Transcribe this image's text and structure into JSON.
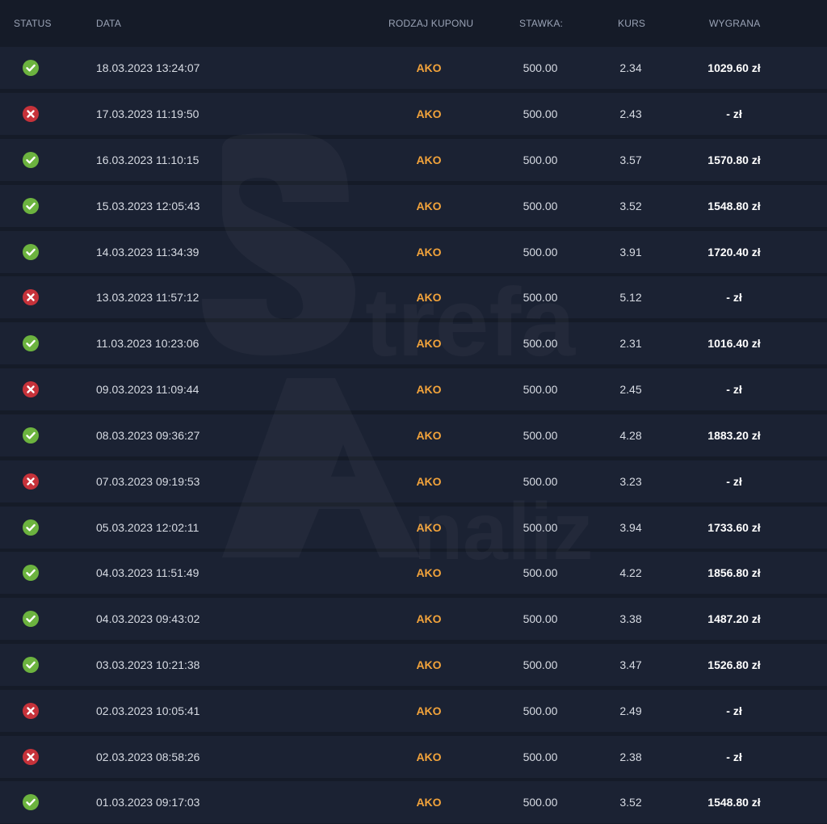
{
  "table": {
    "headers": {
      "status": "STATUS",
      "date": "DATA",
      "coupon_type": "RODZAJ KUPONU",
      "stake": "STAWKA:",
      "odds": "KURS",
      "win": "WYGRANA"
    },
    "rows": [
      {
        "status": "won",
        "date": "18.03.2023 13:24:07",
        "type": "AKO",
        "stake": "500.00",
        "odds": "2.34",
        "win": "1029.60 zł"
      },
      {
        "status": "lost",
        "date": "17.03.2023 11:19:50",
        "type": "AKO",
        "stake": "500.00",
        "odds": "2.43",
        "win": "- zł"
      },
      {
        "status": "won",
        "date": "16.03.2023 11:10:15",
        "type": "AKO",
        "stake": "500.00",
        "odds": "3.57",
        "win": "1570.80 zł"
      },
      {
        "status": "won",
        "date": "15.03.2023 12:05:43",
        "type": "AKO",
        "stake": "500.00",
        "odds": "3.52",
        "win": "1548.80 zł"
      },
      {
        "status": "won",
        "date": "14.03.2023 11:34:39",
        "type": "AKO",
        "stake": "500.00",
        "odds": "3.91",
        "win": "1720.40 zł"
      },
      {
        "status": "lost",
        "date": "13.03.2023 11:57:12",
        "type": "AKO",
        "stake": "500.00",
        "odds": "5.12",
        "win": "- zł"
      },
      {
        "status": "won",
        "date": "11.03.2023 10:23:06",
        "type": "AKO",
        "stake": "500.00",
        "odds": "2.31",
        "win": "1016.40 zł"
      },
      {
        "status": "lost",
        "date": "09.03.2023 11:09:44",
        "type": "AKO",
        "stake": "500.00",
        "odds": "2.45",
        "win": "- zł"
      },
      {
        "status": "won",
        "date": "08.03.2023 09:36:27",
        "type": "AKO",
        "stake": "500.00",
        "odds": "4.28",
        "win": "1883.20 zł"
      },
      {
        "status": "lost",
        "date": "07.03.2023 09:19:53",
        "type": "AKO",
        "stake": "500.00",
        "odds": "3.23",
        "win": "- zł"
      },
      {
        "status": "won",
        "date": "05.03.2023 12:02:11",
        "type": "AKO",
        "stake": "500.00",
        "odds": "3.94",
        "win": "1733.60 zł"
      },
      {
        "status": "won",
        "date": "04.03.2023 11:51:49",
        "type": "AKO",
        "stake": "500.00",
        "odds": "4.22",
        "win": "1856.80 zł"
      },
      {
        "status": "won",
        "date": "04.03.2023 09:43:02",
        "type": "AKO",
        "stake": "500.00",
        "odds": "3.38",
        "win": "1487.20 zł"
      },
      {
        "status": "won",
        "date": "03.03.2023 10:21:38",
        "type": "AKO",
        "stake": "500.00",
        "odds": "3.47",
        "win": "1526.80 zł"
      },
      {
        "status": "lost",
        "date": "02.03.2023 10:05:41",
        "type": "AKO",
        "stake": "500.00",
        "odds": "2.49",
        "win": "- zł"
      },
      {
        "status": "lost",
        "date": "02.03.2023 08:58:26",
        "type": "AKO",
        "stake": "500.00",
        "odds": "2.38",
        "win": "- zł"
      },
      {
        "status": "won",
        "date": "01.03.2023 09:17:03",
        "type": "AKO",
        "stake": "500.00",
        "odds": "3.52",
        "win": "1548.80 zł"
      }
    ]
  },
  "status_icons": {
    "won": {
      "icon": "check-circle-icon",
      "color": "#6cb33f"
    },
    "lost": {
      "icon": "x-circle-icon",
      "color": "#c6323a"
    }
  },
  "watermark": {
    "text_line1": "trefa",
    "text_line2": "naliz"
  },
  "colors": {
    "background": "#151b28",
    "row": "#1b2233",
    "coupon_type": "#f2a33b"
  }
}
